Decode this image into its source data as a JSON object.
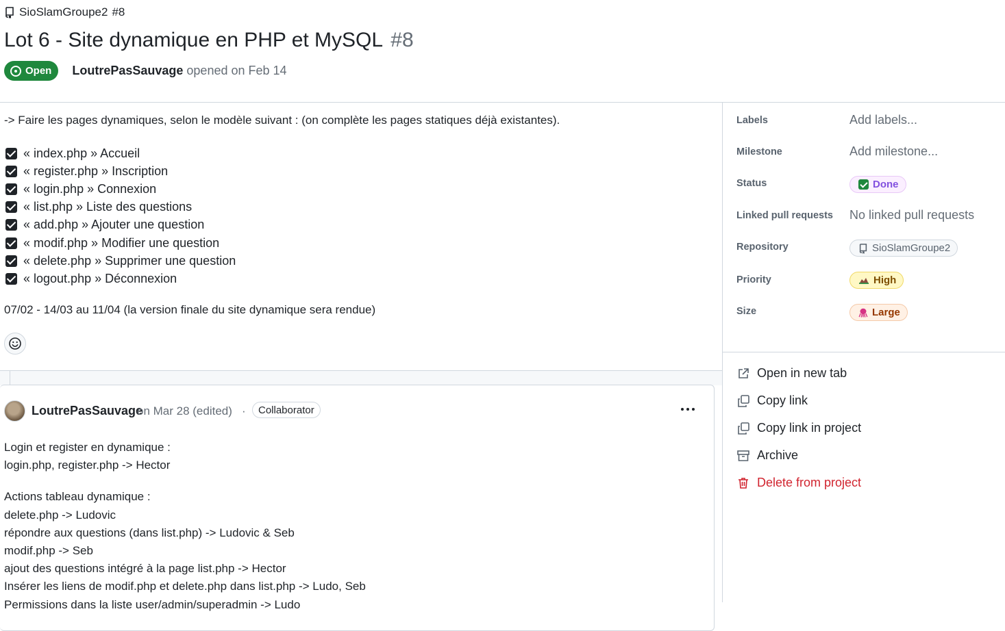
{
  "repo": {
    "name": "SioSlamGroupe2",
    "number": "#8"
  },
  "issue": {
    "title": "Lot 6 - Site dynamique en PHP et MySQL",
    "number": "#8",
    "state": "Open",
    "author": "LoutrePasSauvage",
    "opened_text": "opened on Feb 14"
  },
  "body": {
    "intro": "-> Faire les pages dynamiques, selon le modèle suivant : (on complète les pages statiques déjà existantes).",
    "tasks": [
      {
        "label": "« index.php » Accueil",
        "checked": true
      },
      {
        "label": "« register.php » Inscription",
        "checked": true
      },
      {
        "label": "« login.php » Connexion",
        "checked": true
      },
      {
        "label": "« list.php » Liste des questions",
        "checked": true
      },
      {
        "label": "« add.php » Ajouter une question",
        "checked": true
      },
      {
        "label": "« modif.php » Modifier une question",
        "checked": true
      },
      {
        "label": "« delete.php » Supprimer une question",
        "checked": true
      },
      {
        "label": "« logout.php » Déconnexion",
        "checked": true
      }
    ],
    "dates": "07/02 - 14/03 au 11/04 (la version finale du site dynamique sera rendue)"
  },
  "comment": {
    "author": "LoutrePasSauvage",
    "date": "on Mar 28 (edited)",
    "separator": "·",
    "role": "Collaborator",
    "lines": [
      "Login et register en dynamique :",
      "login.php, register.php -> Hector",
      "",
      "Actions tableau dynamique :",
      "delete.php -> Ludovic",
      "répondre aux questions (dans list.php) -> Ludovic & Seb",
      "modif.php -> Seb",
      "ajout des questions intégré à la page list.php -> Hector",
      "Insérer les liens de modif.php et delete.php dans list.php -> Ludo, Seb",
      "Permissions dans la liste user/admin/superadmin -> Ludo"
    ]
  },
  "sidebar": {
    "labels": {
      "label": "Labels",
      "value": "Add labels..."
    },
    "milestone": {
      "label": "Milestone",
      "value": "Add milestone..."
    },
    "status": {
      "label": "Status",
      "value": "Done",
      "color": "#8250df"
    },
    "linked": {
      "label": "Linked pull requests",
      "value": "No linked pull requests"
    },
    "repository": {
      "label": "Repository",
      "value": "SioSlamGroupe2"
    },
    "priority": {
      "label": "Priority",
      "value": "High",
      "color": "#7d4e00"
    },
    "size": {
      "label": "Size",
      "value": "Large",
      "color": "#953800"
    }
  },
  "actions": {
    "open_tab": "Open in new tab",
    "copy_link": "Copy link",
    "copy_link_project": "Copy link in project",
    "archive": "Archive",
    "delete": "Delete from project"
  },
  "colors": {
    "open_green": "#1f883d",
    "danger": "#d1242f",
    "muted": "#656d76"
  }
}
